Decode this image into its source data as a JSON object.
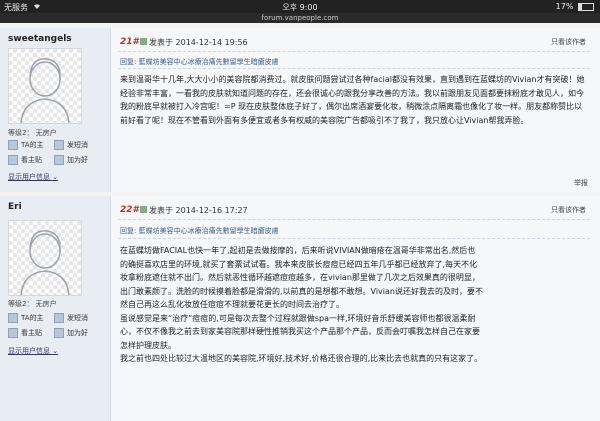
{
  "status_bar": {
    "carrier": "无服务",
    "time": "오후 9:00",
    "battery": "17%"
  },
  "url": "forum.vanpeople.com",
  "posts": [
    {
      "username": "sweetangels",
      "floor": "21#",
      "time": "发表于 2014-12-14 19:56",
      "only_author": "只看该作者",
      "reply_prefix": "回复: 藍蝶坊美容中心冰療治痛先數留學生暗瘡皮膚",
      "body": "来到温哥华十几年,大大小小的美容院都消费过。就皮肤问题尝试过各种facial都没有效果，直到遇到在蓝蝶坊的Vivian才有突破！她经验非常丰富，一看我的皮肤就知道问题的存在，还会很诚心的跟我分享改善的方法。我以前跟朋友见面都要抹粉底才敢见人，如今我的粉底早就被打入冷宫呢！=P 现在皮肤整体底子好了，偶尔出席酒宴要化妆，稍微涂点隔离霜也像化了妆一样。朋友都称赞比以前好看了呢！现在不管看到外面有多便宜或者多有权威的美容院广告都吸引不了我了，我只放心让Vivian帮我弄脸。",
      "level": "等级2： 无房户",
      "actions": [
        "TA的主",
        "发短消",
        "看主贴",
        "加为好"
      ],
      "show_info": "显示用户信息",
      "report": "举报"
    },
    {
      "username": "Eri",
      "floor": "22#",
      "time": "发表于 2014-12-16 17:27",
      "only_author": "只看该作者",
      "reply_prefix": "回复: 藍蝶坊美容中心冰療治痛先數留學生暗瘡皮膚",
      "body_lines": [
        "在蓝蝶坊做FACIAL也快一年了,起初是去做按摩的，后来听说VIVIAN做暗疮在温哥华非常出名,然后也",
        "的确挺喜欢店里的环境,就买了套票试试看。我本来皮肤长痘痘已经四五年几乎都已经放弃了,每天不化",
        "妆拿粉底遮住就不出门。然后就恶性循环越遮痘痘越多，在vivian那里做了几次之后效果真的很明显，",
        "出门敢素颜了。洗脸的时候摸着脸都是滑滑的,以前真的是想都不敢想。Vivian说还好我去的及时，要不",
        "然自己再这么乱化妆放任痘痘不理就要花更长的时间去治疗了。",
        "虽说感觉是来“治疗”痘痘的,可是每次去整个过程就跟做spa一样,环境好音乐舒缓美容师也都很温柔耐",
        "心，不仅不像我之前去到家美容院那样硬性推销我买这个产品那个产品，反而会叮嘱我怎样自己在家要",
        "怎样护理皮肤。",
        "我之前也四处比较过大温地区的美容院,环境好,技术好,价格还很合理的,比来比去也就真的只有这家了。"
      ],
      "level": "等级2： 无房户",
      "actions": [
        "TA的主",
        "发短消",
        "看主贴",
        "加为好"
      ],
      "show_info": "显示用户信息"
    }
  ]
}
